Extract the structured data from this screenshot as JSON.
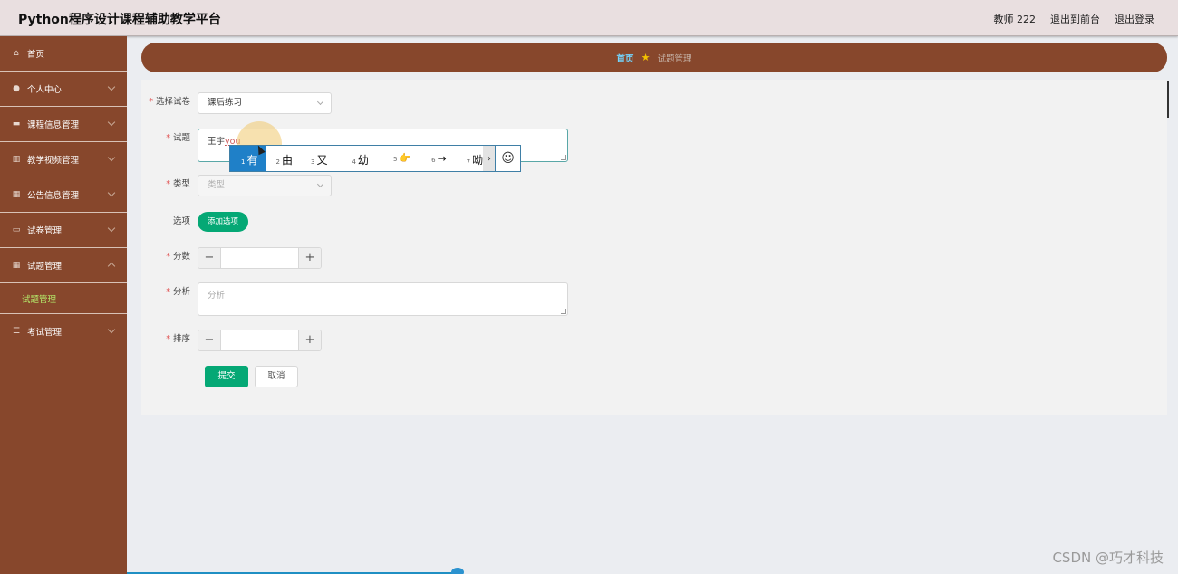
{
  "header": {
    "title": "Python程序设计课程辅助教学平台",
    "user": "教师 222",
    "back_to_front": "退出到前台",
    "logout": "退出登录"
  },
  "sidebar": {
    "items": [
      {
        "label": "首页",
        "icon": "home-icon"
      },
      {
        "label": "个人中心",
        "icon": "user-icon"
      },
      {
        "label": "课程信息管理",
        "icon": "monitor-icon"
      },
      {
        "label": "教学视频管理",
        "icon": "chart-icon"
      },
      {
        "label": "公告信息管理",
        "icon": "grid-icon"
      },
      {
        "label": "试卷管理",
        "icon": "card-icon"
      },
      {
        "label": "试题管理",
        "icon": "table-icon"
      },
      {
        "label": "考试管理",
        "icon": "list-icon"
      }
    ],
    "sub_item": "试题管理"
  },
  "breadcrumb": {
    "home": "首页",
    "current": "试题管理"
  },
  "form": {
    "paper_label": "选择试卷",
    "paper_value": "课后练习",
    "question_label": "试题",
    "question_text": "王宇",
    "question_composing": "you",
    "type_label": "类型",
    "type_placeholder": "类型",
    "options_label": "选项",
    "add_option": "添加选项",
    "score_label": "分数",
    "analysis_label": "分析",
    "analysis_placeholder": "分析",
    "sort_label": "排序",
    "submit": "提交",
    "cancel": "取消"
  },
  "ime": {
    "candidates": [
      {
        "num": "1",
        "char": "有"
      },
      {
        "num": "2",
        "char": "由"
      },
      {
        "num": "3",
        "char": "又"
      },
      {
        "num": "4",
        "char": "幼"
      },
      {
        "num": "5",
        "char": "👉"
      },
      {
        "num": "6",
        "char": "→"
      },
      {
        "num": "7",
        "char": "呦"
      }
    ],
    "next": "›",
    "emoji": "☺"
  },
  "watermark": "CSDN @巧才科技"
}
